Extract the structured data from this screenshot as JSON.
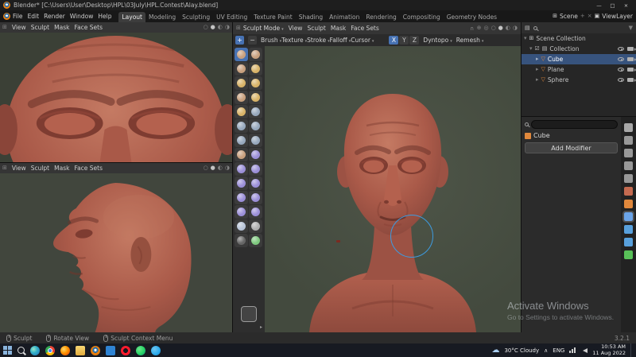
{
  "theme": {
    "accent": "#4772b3",
    "selection_blue": "#37537d",
    "brush_cursor_blue": "#3d9be0",
    "taskbar_bg": "#171a22",
    "clay": "#aa5a49",
    "viewport_bg": "#49503f"
  },
  "titlebar": {
    "title": "Blender* [C:\\Users\\User\\Desktop\\HPL\\03July\\HPL.Contest\\Alay.blend]"
  },
  "menubar": {
    "menus": [
      "File",
      "Edit",
      "Render",
      "Window",
      "Help"
    ],
    "workspaces": [
      "Layout",
      "Modeling",
      "Sculpting",
      "UV Editing",
      "Texture Paint",
      "Shading",
      "Animation",
      "Rendering",
      "Compositing",
      "Geometry Nodes"
    ],
    "active_workspace": "Layout",
    "scene_label": "Scene",
    "view_layer_label": "ViewLayer"
  },
  "viewports": {
    "top_left": {
      "menus": [
        "View",
        "Sculpt",
        "Mask",
        "Face Sets"
      ]
    },
    "bottom_left": {
      "menus": [
        "View",
        "Sculpt",
        "Mask",
        "Face Sets"
      ]
    },
    "main": {
      "mode": "Sculpt Mode",
      "menus": [
        "View",
        "Sculpt",
        "Mask",
        "Face Sets"
      ]
    }
  },
  "tool_settings": {
    "panels": [
      "Brush",
      "Texture",
      "Stroke",
      "Falloff",
      "Cursor"
    ],
    "mirror_axes": [
      "X",
      "Y",
      "Z"
    ],
    "active_axis": "X",
    "dyntopo_label": "Dyntopo",
    "remesh_label": "Remesh"
  },
  "toolbar": {
    "active_brush": "Draw",
    "brushes": [
      {
        "name": "Draw",
        "color": "#c8a07e"
      },
      {
        "name": "Draw Sharp",
        "color": "#c8a07e"
      },
      {
        "name": "Clay",
        "color": "#c8a07e"
      },
      {
        "name": "Clay Strips",
        "color": "#d8b368"
      },
      {
        "name": "Clay Thumb",
        "color": "#d8b368"
      },
      {
        "name": "Layer",
        "color": "#d8b368"
      },
      {
        "name": "Inflate",
        "color": "#c8a07e"
      },
      {
        "name": "Blob",
        "color": "#d8b368"
      },
      {
        "name": "Crease",
        "color": "#d8b368"
      },
      {
        "name": "Smooth",
        "color": "#97a8bd"
      },
      {
        "name": "Flatten",
        "color": "#97a8bd"
      },
      {
        "name": "Fill",
        "color": "#97a8bd"
      },
      {
        "name": "Scrape",
        "color": "#97a8bd"
      },
      {
        "name": "Multi-plane Scrape",
        "color": "#97a8bd"
      },
      {
        "name": "Pinch",
        "color": "#c8a07e"
      },
      {
        "name": "Grab",
        "color": "#9b8fd8"
      },
      {
        "name": "Elastic Deform",
        "color": "#9b8fd8"
      },
      {
        "name": "Snake Hook",
        "color": "#9b8fd8"
      },
      {
        "name": "Thumb",
        "color": "#9b8fd8"
      },
      {
        "name": "Pose",
        "color": "#9b8fd8"
      },
      {
        "name": "Nudge",
        "color": "#9b8fd8"
      },
      {
        "name": "Rotate",
        "color": "#9b8fd8"
      },
      {
        "name": "Slide Relax",
        "color": "#9b8fd8"
      },
      {
        "name": "Boundary",
        "color": "#9b8fd8"
      },
      {
        "name": "Cloth",
        "color": "#b8c4d8"
      },
      {
        "name": "Simplify",
        "color": "#b0b0b0"
      },
      {
        "name": "Mask",
        "color": "#666666"
      },
      {
        "name": "Draw Face Sets",
        "color": "#7ec87e"
      }
    ]
  },
  "outliner": {
    "rows": [
      {
        "label": "Scene Collection"
      },
      {
        "label": "Collection"
      },
      {
        "label": "Cube"
      },
      {
        "label": "Plane"
      },
      {
        "label": "Sphere"
      }
    ]
  },
  "properties": {
    "search_value": "",
    "object_name": "Cube",
    "add_modifier_label": "Add Modifier",
    "tabs": [
      {
        "name": "tool",
        "color": "#a8a8a8"
      },
      {
        "name": "render",
        "color": "#989898"
      },
      {
        "name": "output",
        "color": "#989898"
      },
      {
        "name": "view-layer",
        "color": "#989898"
      },
      {
        "name": "scene",
        "color": "#989898"
      },
      {
        "name": "world",
        "color": "#c46a50"
      },
      {
        "name": "object",
        "color": "#e0883c"
      },
      {
        "name": "modifiers",
        "color": "#6ba4e8",
        "active": true
      },
      {
        "name": "particles",
        "color": "#58a0dc"
      },
      {
        "name": "physics",
        "color": "#58a0dc"
      },
      {
        "name": "object-data",
        "color": "#58c058"
      }
    ]
  },
  "statusbar": {
    "tool": "Sculpt",
    "hints": [
      "Rotate View",
      "Sculpt Context Menu"
    ],
    "version": "3.2.1"
  },
  "watermark": {
    "title": "Activate Windows",
    "subtitle": "Go to Settings to activate Windows."
  },
  "taskbar": {
    "apps": [
      "edge",
      "chrome",
      "firefox",
      "file-explorer",
      "blender",
      "photos",
      "opera",
      "whatsapp",
      "telegram"
    ],
    "weather": "30°C Cloudy",
    "language": "ENG",
    "time": "10:53 AM",
    "date": "11 Aug 2022"
  },
  "icons": {
    "caret": "▾",
    "disclosure_open": "▾",
    "disclosure_closed": "▸",
    "mesh": "▽",
    "checkbox": "☑",
    "editor_grid": "⊞",
    "outliner": "▤",
    "layers": "▣",
    "filter": "▼",
    "magnet": "∪",
    "proportional": "⊕",
    "overlays": "◎",
    "shading_wire": "○",
    "shading_solid": "●",
    "shading_material": "◐",
    "shading_rendered": "◑",
    "cloud": "☁",
    "chevron_up": "∧",
    "minimize": "—",
    "maximize": "□",
    "close": "×",
    "plus": "+",
    "minus": "−"
  }
}
